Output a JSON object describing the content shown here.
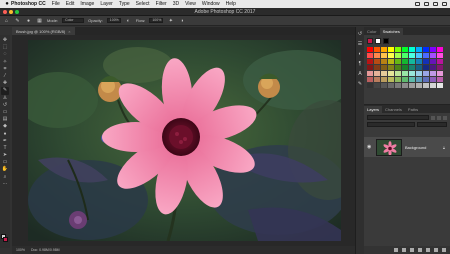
{
  "menubar": {
    "apple": "",
    "items": [
      "Photoshop CC",
      "File",
      "Edit",
      "Image",
      "Layer",
      "Type",
      "Select",
      "Filter",
      "3D",
      "View",
      "Window",
      "Help"
    ]
  },
  "titlebar": {
    "title": "Adobe Photoshop CC 2017"
  },
  "options": {
    "mode_label": "Mode:",
    "mode_value": "Color",
    "opacity_label": "Opacity:",
    "opacity_value": "100%",
    "flow_label": "Flow:",
    "flow_value": "100%"
  },
  "document": {
    "tab_label": "Brush.jpg @ 100% (RGB/8)",
    "close": "×",
    "zoom": "100%",
    "doc_info": "Doc: 0.98M/0.98M"
  },
  "panels": {
    "tabs_top": [
      "Color",
      "Swatches"
    ],
    "tabs_layers": [
      "Layers",
      "Channels",
      "Paths"
    ],
    "layer_name": "Background",
    "swatch_colors": [
      "#ffffff",
      "#000000",
      "#ff0000",
      "#ffff00",
      "#00ff00",
      "#00ffff",
      "#0000ff",
      "#ff00ff"
    ]
  },
  "colors": {
    "accent": "#c71a4a",
    "flower": "#f07ea4",
    "center": "#5a0b24"
  }
}
